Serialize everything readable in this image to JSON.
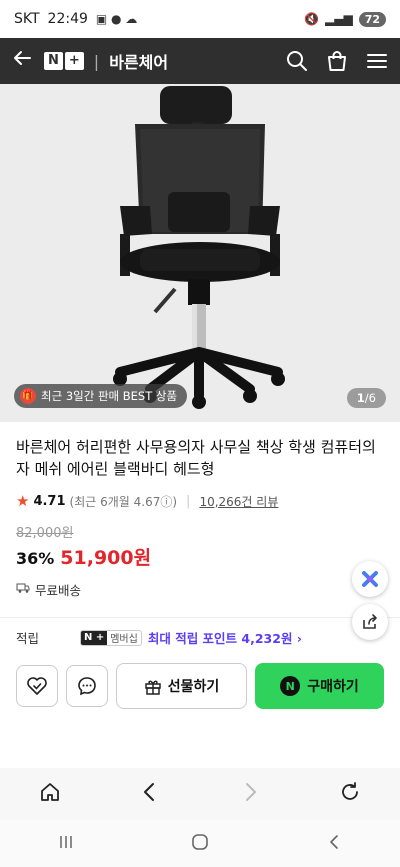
{
  "status_bar": {
    "carrier": "SKT",
    "time": "22:49",
    "battery": "72"
  },
  "header": {
    "logo_n": "N",
    "logo_plus": "+",
    "brand": "바른체어",
    "icons": [
      "back-arrow-icon",
      "search-icon",
      "shopping-bag-icon",
      "menu-icon"
    ]
  },
  "hero": {
    "badge": "최근 3일간 판매 BEST 상품",
    "page_current": "1",
    "page_total": "/6"
  },
  "product": {
    "title": "바른체어 허리편한 사무용의자 사무실 책상 학생 컴퓨터의자 메쉬 에어린 블랙바디 헤드형",
    "rating": "4.71",
    "recent_rating": "(최근 6개월 4.67ⓘ)",
    "reviews": "10,266건 리뷰",
    "original_price": "82,000원",
    "discount": "36%",
    "price": "51,900원",
    "shipping": "무료배송"
  },
  "points": {
    "label": "적립",
    "badge_n": "N +",
    "badge_m": "멤버십",
    "text": "최대 적립 포인트 4,232원 ›"
  },
  "buy_bar": {
    "gift_label": "선물하기",
    "buy_mark": "N",
    "buy_label": "구매하기"
  },
  "colors": {
    "accent_green": "#2fd25a",
    "price_red": "#e3262d",
    "point_purple": "#5a3df5",
    "header_bg": "#2f2f2f"
  }
}
